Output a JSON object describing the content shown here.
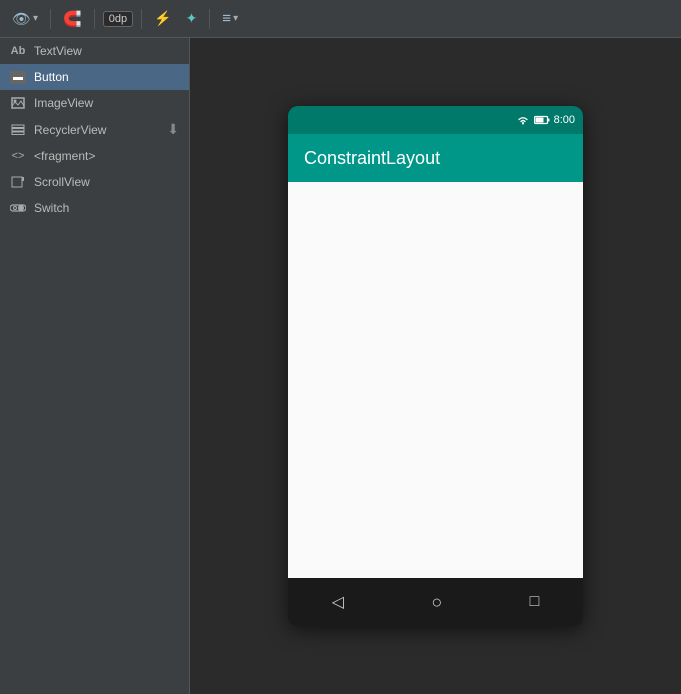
{
  "toolbar": {
    "eye_label": "👁",
    "magnet_label": "⊕",
    "dimension_label": "0dp",
    "align_label": "⚡",
    "wand_label": "✦",
    "text_align_label": "≡"
  },
  "sidebar": {
    "items": [
      {
        "id": "textview",
        "label": "TextView",
        "icon": "text"
      },
      {
        "id": "button",
        "label": "Button",
        "icon": "button"
      },
      {
        "id": "imageview",
        "label": "ImageView",
        "icon": "image"
      },
      {
        "id": "recyclerview",
        "label": "RecyclerView",
        "icon": "list",
        "has_download": true
      },
      {
        "id": "fragment",
        "label": "<fragment>",
        "icon": "code"
      },
      {
        "id": "scrollview",
        "label": "ScrollView",
        "icon": "scroll"
      },
      {
        "id": "switch",
        "label": "Switch",
        "icon": "switch"
      }
    ]
  },
  "phone": {
    "status_bar": {
      "time": "8:00"
    },
    "app_bar": {
      "title": "ConstraintLayout"
    },
    "nav": {
      "back": "◁",
      "home": "○",
      "overview": "□"
    }
  }
}
